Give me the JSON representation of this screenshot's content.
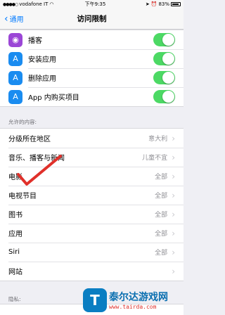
{
  "status_bar": {
    "carrier": "vodafone IT",
    "time": "下午9:35",
    "battery": "83%"
  },
  "nav": {
    "back_label": "通用",
    "title": "访问限制"
  },
  "toggle_items": [
    {
      "label": "播客",
      "icon": "podcast-icon",
      "on": true
    },
    {
      "label": "安装应用",
      "icon": "app-store-icon",
      "on": true
    },
    {
      "label": "删除应用",
      "icon": "app-store-icon",
      "on": true
    },
    {
      "label": "App 内购买项目",
      "icon": "app-store-icon",
      "on": true
    }
  ],
  "allowed_content": {
    "header": "允许的内容:",
    "items": [
      {
        "label": "分级所在地区",
        "value": "意大利"
      },
      {
        "label": "音乐、播客与新闻",
        "value": "儿童不宜"
      },
      {
        "label": "电影",
        "value": "全部"
      },
      {
        "label": "电视节目",
        "value": "全部"
      },
      {
        "label": "图书",
        "value": "全部"
      },
      {
        "label": "应用",
        "value": "全部"
      },
      {
        "label": "Siri",
        "value": "全部"
      },
      {
        "label": "网站",
        "value": ""
      }
    ]
  },
  "privacy": {
    "header": "隐私:"
  },
  "watermark": {
    "logo_char": "T",
    "name": "泰尔达游戏网",
    "url": "www.tairda.com"
  },
  "colors": {
    "toggle_on": "#4cd964",
    "link": "#007aff",
    "checkmark": "#e0302a"
  }
}
